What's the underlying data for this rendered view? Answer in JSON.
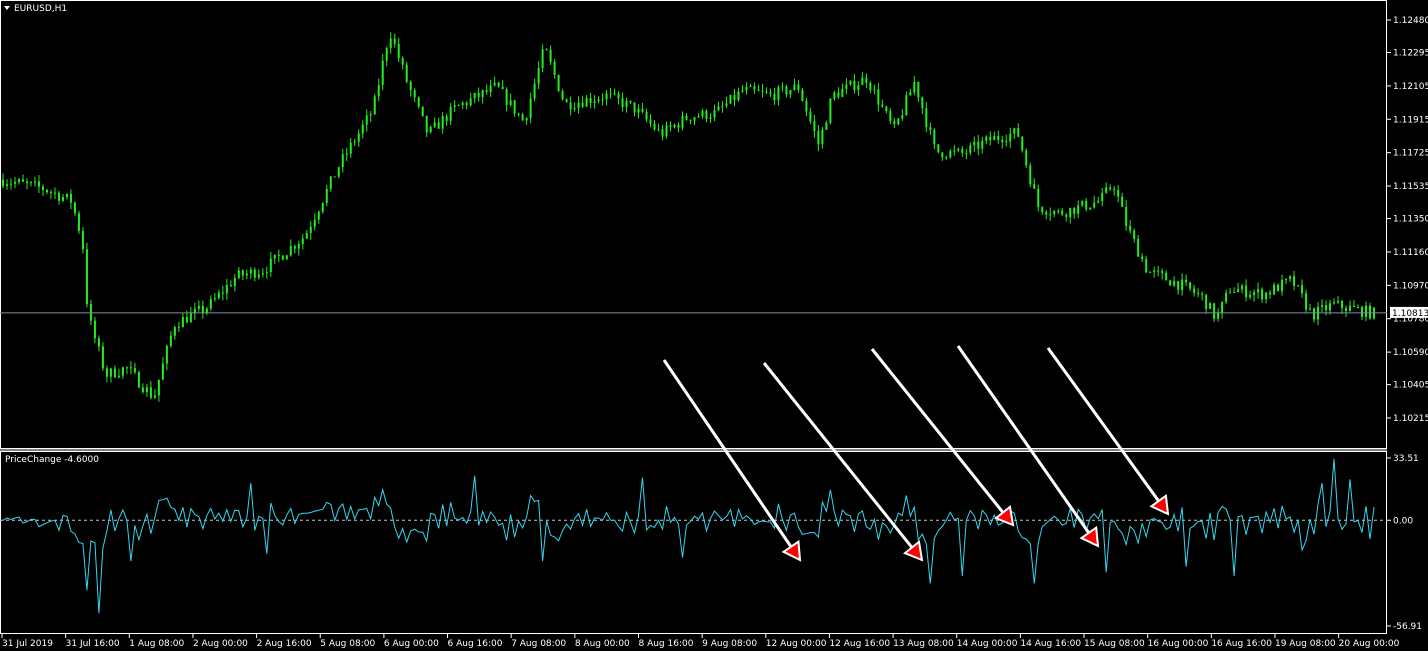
{
  "window": {
    "symbol_title": "EURUSD,H1"
  },
  "indicator": {
    "title": "PriceChange -4.6000"
  },
  "current_price": "1.10813",
  "colors": {
    "background": "#000000",
    "candles": "#22ee22",
    "indicator_line": "#34d7f0",
    "price_line": "#7f8fa8",
    "arrow": "#ffffff",
    "arrow_head": "#ff0000"
  },
  "chart_data": [
    {
      "type": "candlestick",
      "title": "EURUSD,H1",
      "y_axis_ticks": [
        "1.12480",
        "1.12295",
        "1.12105",
        "1.11915",
        "1.11725",
        "1.11535",
        "1.11350",
        "1.11160",
        "1.10970",
        "1.10780",
        "1.10590",
        "1.10405",
        "1.10215"
      ],
      "ylim": [
        1.10215,
        1.1248
      ],
      "close_path": [
        [
          0,
          1.1157
        ],
        [
          0.03,
          1.1152
        ],
        [
          0.05,
          1.1145
        ],
        [
          0.058,
          1.1122
        ],
        [
          0.062,
          1.108
        ],
        [
          0.075,
          1.1046
        ],
        [
          0.09,
          1.105
        ],
        [
          0.11,
          1.1033
        ],
        [
          0.125,
          1.1075
        ],
        [
          0.15,
          1.1085
        ],
        [
          0.17,
          1.1102
        ],
        [
          0.19,
          1.1106
        ],
        [
          0.22,
          1.1125
        ],
        [
          0.245,
          1.1165
        ],
        [
          0.27,
          1.1197
        ],
        [
          0.282,
          1.1242
        ],
        [
          0.295,
          1.1212
        ],
        [
          0.31,
          1.1183
        ],
        [
          0.33,
          1.1198
        ],
        [
          0.36,
          1.121
        ],
        [
          0.38,
          1.119
        ],
        [
          0.395,
          1.1232
        ],
        [
          0.41,
          1.12
        ],
        [
          0.44,
          1.1205
        ],
        [
          0.46,
          1.1198
        ],
        [
          0.48,
          1.1183
        ],
        [
          0.5,
          1.1193
        ],
        [
          0.52,
          1.1195
        ],
        [
          0.54,
          1.1208
        ],
        [
          0.56,
          1.1205
        ],
        [
          0.58,
          1.121
        ],
        [
          0.595,
          1.1177
        ],
        [
          0.605,
          1.1205
        ],
        [
          0.63,
          1.1215
        ],
        [
          0.65,
          1.1185
        ],
        [
          0.665,
          1.1213
        ],
        [
          0.68,
          1.1173
        ],
        [
          0.7,
          1.1172
        ],
        [
          0.72,
          1.118
        ],
        [
          0.74,
          1.1184
        ],
        [
          0.755,
          1.1142
        ],
        [
          0.77,
          1.1138
        ],
        [
          0.8,
          1.1145
        ],
        [
          0.81,
          1.1155
        ],
        [
          0.82,
          1.113
        ],
        [
          0.835,
          1.1105
        ],
        [
          0.86,
          1.1097
        ],
        [
          0.875,
          1.109
        ],
        [
          0.885,
          1.1078
        ],
        [
          0.895,
          1.1095
        ],
        [
          0.92,
          1.1092
        ],
        [
          0.94,
          1.11
        ],
        [
          0.955,
          1.108
        ],
        [
          0.97,
          1.1086
        ],
        [
          1.0,
          1.1081
        ]
      ],
      "current_price": 1.10813
    },
    {
      "type": "line",
      "title": "PriceChange -4.6000",
      "y_axis_ticks": [
        "33.51",
        "0.00",
        "-56.91"
      ],
      "ylim": [
        -56.91,
        33.51
      ],
      "zero_line": true,
      "annotations": "five white arrows pointing to negative spikes"
    }
  ],
  "time_axis": {
    "labels": [
      "31 Jul 2019",
      "31 Jul 16:00",
      "1 Aug 08:00",
      "2 Aug 00:00",
      "2 Aug 16:00",
      "5 Aug 08:00",
      "6 Aug 00:00",
      "6 Aug 16:00",
      "7 Aug 08:00",
      "8 Aug 00:00",
      "8 Aug 16:00",
      "9 Aug 08:00",
      "12 Aug 00:00",
      "12 Aug 16:00",
      "13 Aug 08:00",
      "14 Aug 00:00",
      "14 Aug 16:00",
      "15 Aug 08:00",
      "16 Aug 00:00",
      "16 Aug 16:00",
      "19 Aug 08:00",
      "20 Aug 00:00"
    ]
  }
}
